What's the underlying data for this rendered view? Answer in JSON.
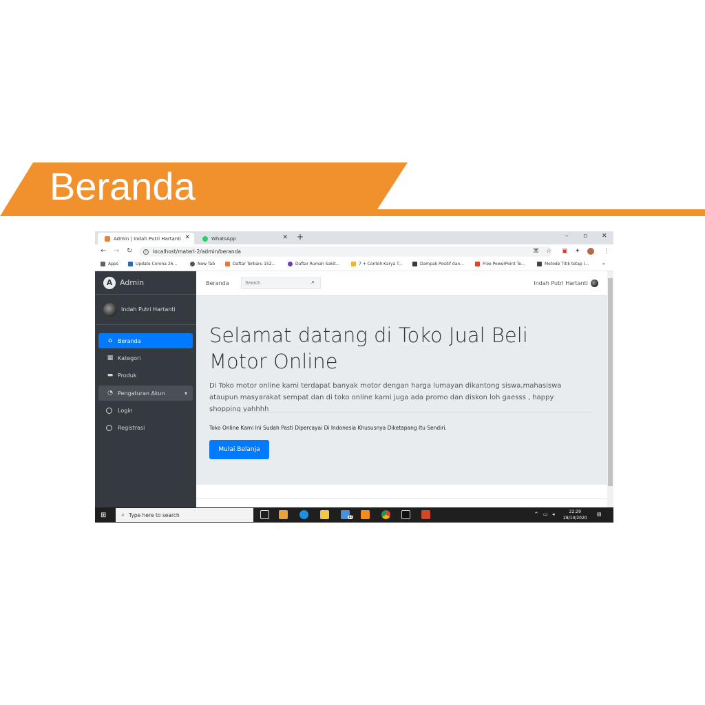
{
  "banner": {
    "title": "Beranda",
    "color": "#f0912e"
  },
  "browser": {
    "tabs": [
      {
        "label": "Admin | Indah Putri Hartanti",
        "icon": "admin-favicon"
      },
      {
        "label": "WhatsApp",
        "icon": "whatsapp-icon"
      }
    ],
    "url": "localhost/materi-2/admin/beranda",
    "bookmarks": [
      "Apps",
      "Update Corona 26...",
      "New Tab",
      "Daftar Terbaru 152...",
      "Daftar Rumah Sakit...",
      "7 + Contoh Karya T...",
      "Dampak Positif dan...",
      "Free PowerPoint Te...",
      "Metode Titik tetap (..."
    ]
  },
  "sidebar": {
    "brand": "Admin",
    "user": "Indah Putri Hartanti",
    "items": [
      {
        "label": "Beranda",
        "icon": "home-icon"
      },
      {
        "label": "Kategori",
        "icon": "grid-icon"
      },
      {
        "label": "Produk",
        "icon": "box-icon"
      },
      {
        "label": "Pengaturan Akun",
        "icon": "gauge-icon"
      },
      {
        "label": "Login",
        "icon": "circle-icon"
      },
      {
        "label": "Registrasi",
        "icon": "circle-icon"
      }
    ]
  },
  "topnav": {
    "crumb": "Beranda",
    "search_placeholder": "Search",
    "user": "Indah Putri Hartanti"
  },
  "content": {
    "heading": "Selamat datang di Toko Jual Beli Motor Online",
    "lead": "Di Toko motor online kami terdapat banyak motor dengan harga lumayan dikantong siswa,mahasiswa ataupun masyarakat sempat dan di toko online kami juga ada promo dan diskon loh gaesss , happy shopping yahhhh",
    "note": "Toko Online Kami Ini Sudah Pasti Dipercayai Di Indonesia Khususnya Diketapang Itu Sendiri.",
    "cta": "Mulai Belanja",
    "accent": "#007bff"
  },
  "taskbar": {
    "search_placeholder": "Type here to search",
    "time": "22:29",
    "date": "28/10/2020",
    "badge_count": "15"
  }
}
